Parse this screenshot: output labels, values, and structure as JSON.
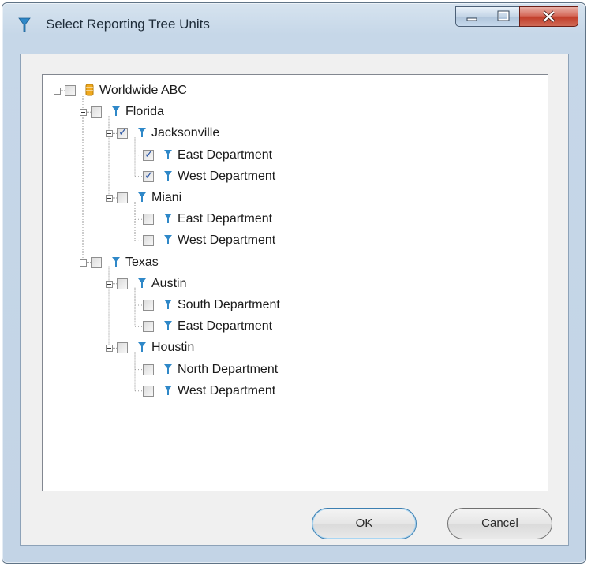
{
  "window": {
    "title": "Select Reporting Tree Units",
    "icon": "filter-funnel-icon",
    "caption_buttons": [
      "minimize-icon",
      "maximize-icon",
      "close-icon"
    ]
  },
  "tree": [
    {
      "label": "Worldwide ABC",
      "icon": "database-icon",
      "checked": false,
      "expanded": true,
      "level": 0
    },
    {
      "label": "Florida",
      "icon": "filter-funnel-icon",
      "checked": false,
      "expanded": true,
      "level": 1
    },
    {
      "label": "Jacksonville",
      "icon": "filter-funnel-icon",
      "checked": true,
      "expanded": true,
      "level": 2
    },
    {
      "label": "East Department",
      "icon": "filter-funnel-icon",
      "checked": true,
      "level": 3
    },
    {
      "label": "West Department",
      "icon": "filter-funnel-icon",
      "checked": true,
      "level": 3
    },
    {
      "label": "Miani",
      "icon": "filter-funnel-icon",
      "checked": false,
      "expanded": true,
      "level": 2
    },
    {
      "label": "East Department",
      "icon": "filter-funnel-icon",
      "checked": false,
      "level": 3
    },
    {
      "label": "West Department",
      "icon": "filter-funnel-icon",
      "checked": false,
      "level": 3
    },
    {
      "label": "Texas",
      "icon": "filter-funnel-icon",
      "checked": false,
      "expanded": true,
      "level": 1
    },
    {
      "label": "Austin",
      "icon": "filter-funnel-icon",
      "checked": false,
      "expanded": true,
      "level": 2
    },
    {
      "label": "South Department",
      "icon": "filter-funnel-icon",
      "checked": false,
      "level": 3
    },
    {
      "label": "East Department",
      "icon": "filter-funnel-icon",
      "checked": false,
      "level": 3
    },
    {
      "label": "Houstin",
      "icon": "filter-funnel-icon",
      "checked": false,
      "expanded": true,
      "level": 2
    },
    {
      "label": "North Department",
      "icon": "filter-funnel-icon",
      "checked": false,
      "level": 3
    },
    {
      "label": "West Department",
      "icon": "filter-funnel-icon",
      "checked": false,
      "level": 3
    }
  ],
  "buttons": {
    "ok": "OK",
    "cancel": "Cancel"
  },
  "colors": {
    "accent_icon": "#2f88c8",
    "database_icon": "#f0a91e",
    "check_mark": "#2a55a5",
    "close_button": "#c2402c"
  }
}
